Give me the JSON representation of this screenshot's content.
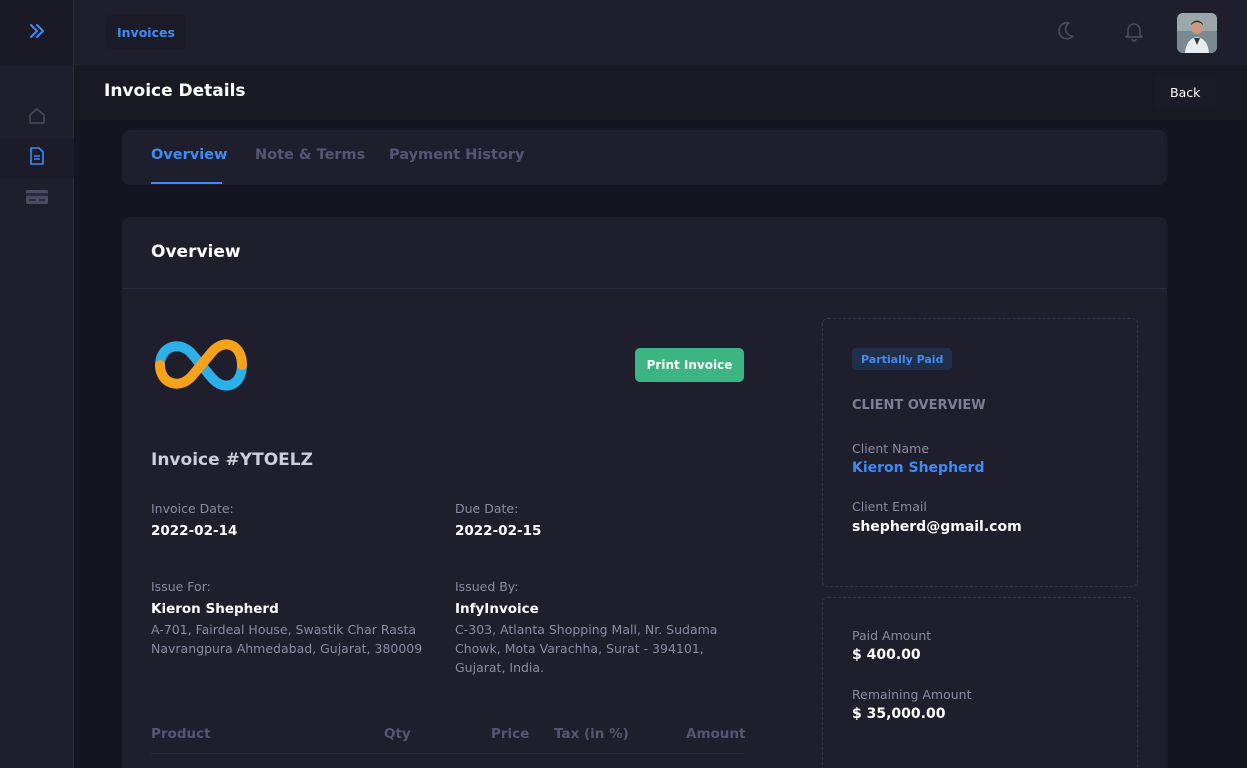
{
  "topbar": {
    "breadcrumb": "Invoices",
    "icons": [
      "moon-icon",
      "bell-icon"
    ]
  },
  "sidebar": {
    "toggle_icon": "double-chevron-right-icon",
    "items": [
      {
        "icon": "home-icon",
        "active": false
      },
      {
        "icon": "document-icon",
        "active": true
      },
      {
        "icon": "credit-card-icon",
        "active": false
      }
    ]
  },
  "page": {
    "title": "Invoice Details",
    "back_label": "Back"
  },
  "tabs": [
    {
      "label": "Overview",
      "active": true
    },
    {
      "label": "Note & Terms",
      "active": false
    },
    {
      "label": "Payment History",
      "active": false
    }
  ],
  "overview": {
    "title": "Overview",
    "print_label": "Print Invoice",
    "invoice_number": "Invoice #YTOELZ",
    "invoice_date_label": "Invoice Date:",
    "invoice_date": "2022-02-14",
    "due_date_label": "Due Date:",
    "due_date": "2022-02-15",
    "issue_for_label": "Issue For:",
    "issue_for_name": "Kieron Shepherd",
    "issue_for_address": [
      "A-701, Fairdeal House, Swastik Char Rasta",
      "Navrangpura Ahmedabad, Gujarat, 380009"
    ],
    "issued_by_label": "Issued By:",
    "issued_by_name": "InfyInvoice",
    "issued_by_address": [
      "C-303, Atlanta Shopping Mall, Nr. Sudama",
      "Chowk, Mota Varachha, Surat - 394101,",
      "Gujarat, India."
    ],
    "table_headers": [
      "Product",
      "Qty",
      "Price",
      "Tax (in %)",
      "Amount"
    ]
  },
  "client_overview": {
    "status_badge": "Partially Paid",
    "heading": "CLIENT OVERVIEW",
    "name_label": "Client Name",
    "name": "Kieron Shepherd",
    "email_label": "Client Email",
    "email": "shepherd@gmail.com"
  },
  "payment_summary": {
    "paid_label": "Paid Amount",
    "paid_amount": "$  400.00",
    "remaining_label": "Remaining Amount",
    "remaining_amount": "$  35,000.00"
  },
  "colors": {
    "accent": "#3e8bf6",
    "success": "#3cb582",
    "background": "#151521",
    "card": "#1e1e2d"
  }
}
